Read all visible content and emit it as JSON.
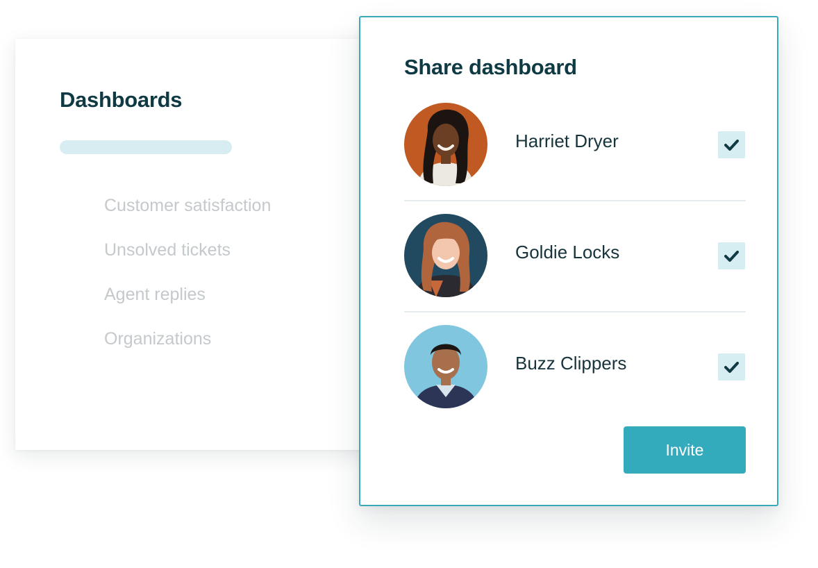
{
  "dashboards": {
    "title": "Dashboards",
    "items": [
      {
        "label": "Customer satisfaction"
      },
      {
        "label": "Unsolved tickets"
      },
      {
        "label": "Agent replies"
      },
      {
        "label": "Organizations"
      }
    ]
  },
  "share": {
    "title": "Share dashboard",
    "users": [
      {
        "name": "Harriet Dryer",
        "checked": true,
        "avatar_bg": "#c05a22"
      },
      {
        "name": "Goldie Locks",
        "checked": true,
        "avatar_bg": "#214a60"
      },
      {
        "name": "Buzz Clippers",
        "checked": true,
        "avatar_bg": "#7fc6de"
      }
    ],
    "invite_label": "Invite"
  },
  "colors": {
    "accent": "#34abbd",
    "heading": "#0f3a44",
    "muted_text": "#c4c9cc",
    "check_bg": "#d6edf1"
  }
}
